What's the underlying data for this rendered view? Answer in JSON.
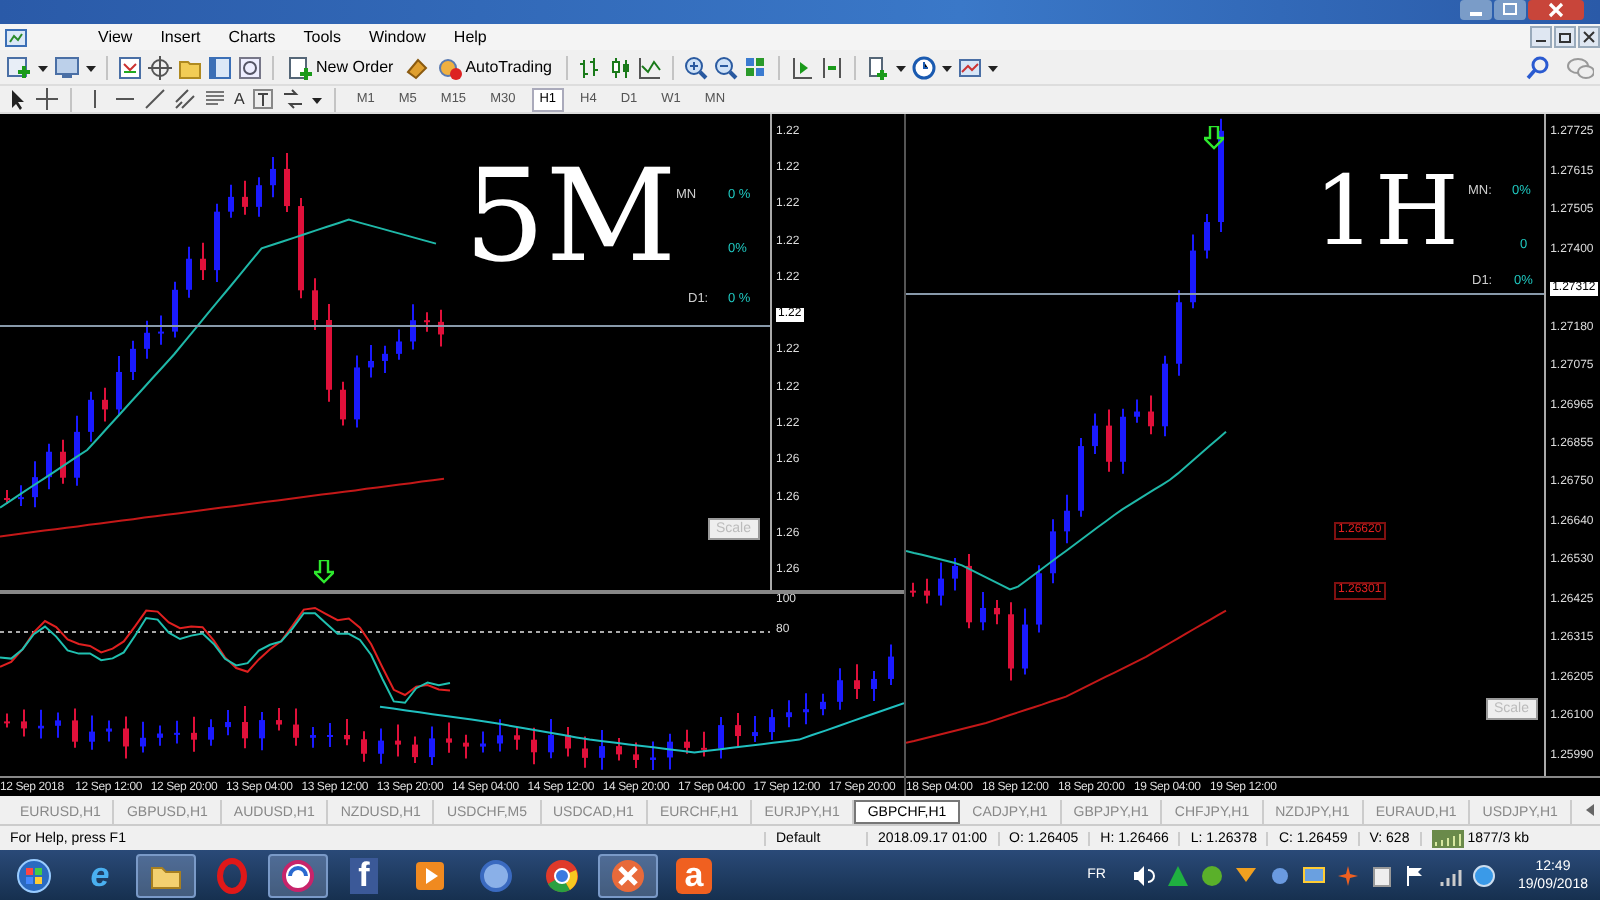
{
  "menu": [
    "View",
    "Insert",
    "Charts",
    "Tools",
    "Window",
    "Help"
  ],
  "toolbar": {
    "new_order": "New Order",
    "autotrading": "AutoTrading",
    "text_tool": "A",
    "timeframes": [
      {
        "label": "M1",
        "selected": false
      },
      {
        "label": "M5",
        "selected": false
      },
      {
        "label": "M15",
        "selected": false
      },
      {
        "label": "M30",
        "selected": false
      },
      {
        "label": "H1",
        "selected": true
      },
      {
        "label": "H4",
        "selected": false
      },
      {
        "label": "D1",
        "selected": false
      },
      {
        "label": "W1",
        "selected": false
      },
      {
        "label": "MN",
        "selected": false
      }
    ]
  },
  "charts": [
    {
      "annotation": "5M",
      "overlay": [
        {
          "text": "MN",
          "kind": "label"
        },
        {
          "text": "0 %",
          "kind": "value"
        },
        {
          "text": "0%",
          "kind": "value"
        },
        {
          "text": "D1:",
          "kind": "label"
        },
        {
          "text": "0 %",
          "kind": "value"
        }
      ],
      "price_labels": [
        "1.22",
        "1.22",
        "1.22",
        "1.22",
        "1.22",
        "1.22",
        "1.22",
        "1.22",
        "1.26",
        "1.26",
        "1.26",
        "1.26"
      ],
      "current_price": "1.22",
      "scale_button": "Scale",
      "indicator_labels": [
        "100",
        "80"
      ],
      "time_labels": [
        "12 Sep 2018",
        "12 Sep 12:00",
        "12 Sep 20:00",
        "13 Sep 04:00",
        "13 Sep 12:00",
        "13 Sep 20:00",
        "14 Sep 04:00",
        "14 Sep 12:00",
        "14 Sep 20:00",
        "17 Sep 04:00",
        "17 Sep 12:00",
        "17 Sep 20:00"
      ]
    },
    {
      "annotation": "1H",
      "overlay": [
        {
          "text": "MN:",
          "kind": "label"
        },
        {
          "text": "0%",
          "kind": "value"
        },
        {
          "text": "0",
          "kind": "value"
        },
        {
          "text": "D1:",
          "kind": "label"
        },
        {
          "text": "0%",
          "kind": "value"
        }
      ],
      "price_labels": [
        "1.27725",
        "1.27615",
        "1.27505",
        "1.27400",
        "1.27180",
        "1.27075",
        "1.26965",
        "1.26855",
        "1.26750",
        "1.26640",
        "1.26530",
        "1.26425",
        "1.26315",
        "1.26205",
        "1.26100",
        "1.25990"
      ],
      "current_price": "1.27312",
      "level_labels": [
        "1.26620",
        "1.26301"
      ],
      "scale_button": "Scale",
      "time_labels": [
        "18 Sep 04:00",
        "18 Sep 12:00",
        "18 Sep 20:00",
        "19 Sep 04:00",
        "19 Sep 12:00"
      ]
    }
  ],
  "tabs": [
    {
      "label": "EURUSD,H1",
      "selected": false
    },
    {
      "label": "GBPUSD,H1",
      "selected": false
    },
    {
      "label": "AUDUSD,H1",
      "selected": false
    },
    {
      "label": "NZDUSD,H1",
      "selected": false
    },
    {
      "label": "USDCHF,M5",
      "selected": false
    },
    {
      "label": "USDCAD,H1",
      "selected": false
    },
    {
      "label": "EURCHF,H1",
      "selected": false
    },
    {
      "label": "EURJPY,H1",
      "selected": false
    },
    {
      "label": "GBPCHF,H1",
      "selected": true
    },
    {
      "label": "CADJPY,H1",
      "selected": false
    },
    {
      "label": "GBPJPY,H1",
      "selected": false
    },
    {
      "label": "CHFJPY,H1",
      "selected": false
    },
    {
      "label": "NZDJPY,H1",
      "selected": false
    },
    {
      "label": "EURAUD,H1",
      "selected": false
    },
    {
      "label": "USDJPY,H1",
      "selected": false
    }
  ],
  "status_bar": {
    "help": "For Help, press F1",
    "profile": "Default",
    "fields": [
      "2018.09.17 01:00",
      "O: 1.26405",
      "H: 1.26466",
      "L: 1.26378",
      "C: 1.26459",
      "V: 628"
    ],
    "traffic": "1877/3 kb"
  },
  "taskbar": {
    "apps": [
      {
        "kind": "orb",
        "active": false
      },
      {
        "kind": "letter",
        "glyph": "e",
        "active": false
      },
      {
        "kind": "folder",
        "active": true
      },
      {
        "kind": "ring",
        "active": false
      },
      {
        "kind": "swirl",
        "active": true
      },
      {
        "kind": "letter",
        "glyph": "f",
        "active": false
      },
      {
        "kind": "play",
        "active": false
      },
      {
        "kind": "circle",
        "active": false
      },
      {
        "kind": "chrome",
        "active": false
      },
      {
        "kind": "cross",
        "active": true
      },
      {
        "kind": "letter",
        "glyph": "a",
        "active": false
      }
    ],
    "language": "FR",
    "time": "12:49",
    "date": "19/09/2018"
  }
}
